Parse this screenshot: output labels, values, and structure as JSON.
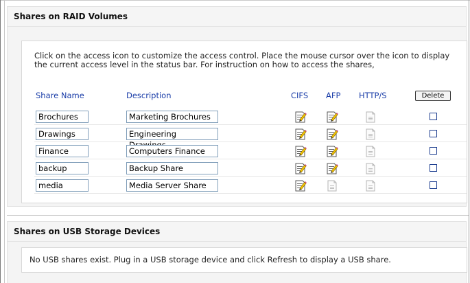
{
  "raid": {
    "title": "Shares on RAID Volumes",
    "intro": "Click on the access icon to customize the access control. Place the mouse cursor over the icon to display the current access level in the status bar. For instruction on how to access the shares,",
    "headers": {
      "share_name": "Share Name",
      "description": "Description",
      "cifs": "CIFS",
      "afp": "AFP",
      "http": "HTTP/S",
      "delete": "Delete"
    },
    "shares": [
      {
        "name": "Brochures",
        "description": "Marketing Brochures",
        "cifs": "enabled",
        "afp": "enabled",
        "http": "disabled",
        "selected": false
      },
      {
        "name": "Drawings",
        "description": "Engineering Drawings",
        "cifs": "enabled",
        "afp": "enabled",
        "http": "disabled",
        "selected": false
      },
      {
        "name": "Finance",
        "description": "Computers Finance",
        "cifs": "enabled",
        "afp": "enabled",
        "http": "disabled",
        "selected": false
      },
      {
        "name": "backup",
        "description": "Backup Share",
        "cifs": "enabled",
        "afp": "enabled",
        "http": "disabled",
        "selected": false
      },
      {
        "name": "media",
        "description": "Media Server Share",
        "cifs": "enabled",
        "afp": "disabled",
        "http": "disabled",
        "selected": false
      }
    ]
  },
  "usb": {
    "title": "Shares on USB Storage Devices",
    "message": "No USB shares exist. Plug in a USB storage device and click Refresh to display a USB share."
  },
  "icons": {
    "enabled": "access-enabled-icon",
    "disabled": "access-disabled-icon"
  },
  "colors": {
    "header_text": "#1a3da8",
    "panel_bg": "#f4f4f4",
    "input_border": "#7f9db9",
    "checkbox_border": "#1c3d8f"
  }
}
